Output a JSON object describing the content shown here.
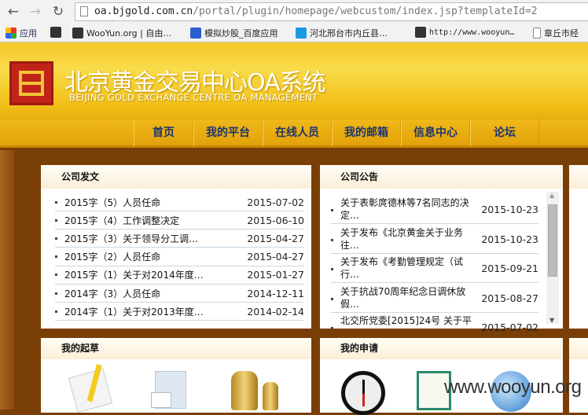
{
  "browser": {
    "url_host": "oa.bjgold.com.cn",
    "url_path": "/portal/plugin/homepage/webcustom/index.jsp?templateId=2",
    "bookmarks": [
      "应用",
      "WooYun.org | 自由…",
      "模拟炒股_百度应用",
      "河北邢台市内丘县…",
      "http://www.wooyun…",
      "章丘市经"
    ]
  },
  "header": {
    "title": "北京黄金交易中心OA系统",
    "subtitle": "BEIJING GOLD EXCHANGE CENTRE OA MANAGEMENT"
  },
  "nav": [
    "首页",
    "我的平台",
    "在线人员",
    "我的邮箱",
    "信息中心",
    "论坛"
  ],
  "company_docs": {
    "title": "公司发文",
    "items": [
      {
        "text": "2015字（5）人员任命",
        "date": "2015-07-02"
      },
      {
        "text": "2015字（4）工作调整决定",
        "date": "2015-06-10"
      },
      {
        "text": "2015字（3）关于领导分工调…",
        "date": "2015-04-27"
      },
      {
        "text": "2015字（2）人员任命",
        "date": "2015-04-27"
      },
      {
        "text": "2015字（1）关于对2014年度…",
        "date": "2015-01-27"
      },
      {
        "text": "2014字（3）人员任命",
        "date": "2014-12-11"
      },
      {
        "text": "2014字（1）关于对2013年度…",
        "date": "2014-02-14"
      }
    ]
  },
  "announcements": {
    "title": "公司公告",
    "items": [
      {
        "line1": "关于表彰庹德林等7名同志的决",
        "line2": "定…",
        "date": "2015-10-23"
      },
      {
        "line1": "关于发布《北京黄金关于业务",
        "line2": "往…",
        "date": "2015-10-23"
      },
      {
        "line1": "关于发布《考勤管理规定（试",
        "line2": "行…",
        "date": "2015-09-21"
      },
      {
        "line1": "关于抗战70周年纪念日调休放",
        "line2": "假…",
        "date": "2015-08-27"
      },
      {
        "line1": "北交所党委[2015]24号 关于平",
        "line2": "",
        "date": "2015-07-02"
      }
    ]
  },
  "drafts": {
    "title": "我的起草"
  },
  "applications": {
    "title": "我的申请"
  },
  "watermark": "www.wooyun.org"
}
